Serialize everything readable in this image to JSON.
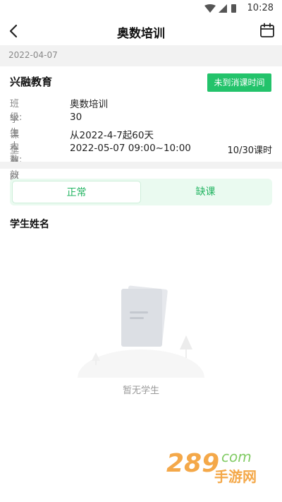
{
  "status_bar": {
    "time": "10:28"
  },
  "header": {
    "title": "奥数培训"
  },
  "date_band": {
    "date": "2022-04-07"
  },
  "course": {
    "org": "兴融教育",
    "status_button": "未到消课时间",
    "rows": [
      {
        "label": "班　　级:",
        "value": "奥数培训"
      },
      {
        "label": "学 生 人 数:",
        "value": "30"
      },
      {
        "label": "课程有效期:",
        "value": "从2022-4-7起60天"
      },
      {
        "label": "上 课 时 间:",
        "value": "2022-05-07 09:00~10:00"
      }
    ],
    "lessons": "10/30课时"
  },
  "tabs": {
    "normal": "正常",
    "absent": "缺课"
  },
  "students": {
    "header": "学生姓名",
    "empty_text": "暂无学生"
  },
  "colors": {
    "accent": "#23c36b",
    "tab_bg": "#eafaf0",
    "band": "#f2f2f2"
  },
  "watermark": {
    "number": "289",
    "domain": "com",
    "cn": "手游网"
  }
}
